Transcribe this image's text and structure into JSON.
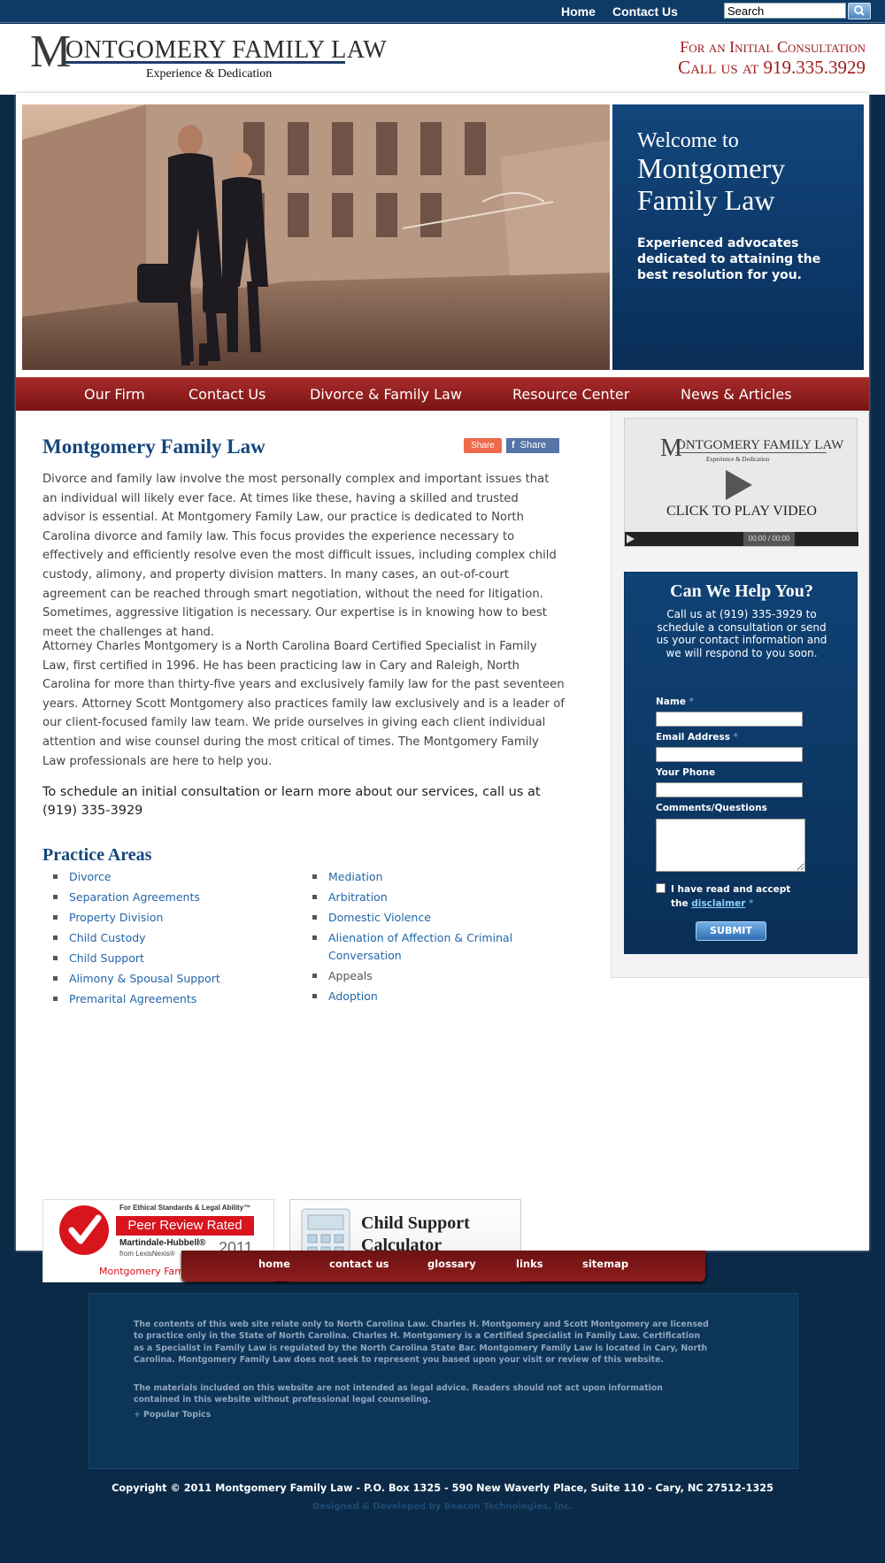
{
  "topbar": {
    "links": [
      "Home",
      "Contact Us"
    ],
    "search_value": "Search"
  },
  "header": {
    "logo_initial": "M",
    "logo_name": "ONTGOMERY FAMILY LAW",
    "logo_tagline": "Experience & Dedication",
    "consult_line1": "For an Initial Consultation",
    "consult_line2": "Call us at 919.335.3929"
  },
  "hero": {
    "welcome_line1": "Welcome to",
    "welcome_line2": "Montgomery Family Law",
    "welcome_sub": "Experienced advocates dedicated to attaining the best resolution for you."
  },
  "main_nav": [
    "Our Firm",
    "Contact Us",
    "Divorce & Family Law",
    "Resource Center",
    "News & Articles"
  ],
  "content": {
    "title": "Montgomery Family Law",
    "share_label_1": "Share",
    "share_label_2": "Share",
    "paragraph_1": "Divorce and family law involve the most personally complex and important issues that an individual will likely ever face. At times like these, having a skilled and trusted advisor is essential. At Montgomery Family Law, our practice is dedicated to North Carolina divorce and family law. This focus provides the experience necessary to effectively and efficiently resolve even the most difficult issues, including complex child custody, alimony, and property division matters. In many cases, an out-of-court agreement can be reached through smart negotiation, without the need for litigation. Sometimes, aggressive litigation is necessary. Our expertise is in knowing how to best meet the challenges at hand.",
    "paragraph_2": "Attorney Charles Montgomery is a North Carolina Board Certified Specialist in Family Law, first certified in 1996. He has been practicing law in Cary and Raleigh, North Carolina for more than thirty-five years and exclusively family law for the past seventeen years. Attorney Scott Montgomery also practices family law exclusively and is a leader of our client-focused family law team. We pride ourselves in giving each client individual attention and wise counsel during the most critical of times. The Montgomery Family Law professionals are here to help you.",
    "paragraph_3": "To schedule an initial consultation or learn more about our services, call us at (919) 335-3929",
    "practice_title": "Practice Areas",
    "practice_left": [
      "Divorce",
      "Separation Agreements",
      "Property Division",
      "Child Custody",
      "Child Support",
      "Alimony & Spousal Support",
      "Premarital Agreements"
    ],
    "practice_right": [
      "Mediation",
      "Arbitration",
      "Domestic Violence",
      "Alienation of Affection & Criminal Conversation",
      "Appeals",
      "Adoption"
    ],
    "badge_peer": {
      "top": "For Ethical Standards & Legal Ability™",
      "rated": "Peer Review Rated",
      "brand": "Martindale-Hubbell®",
      "from": "from LexisNexis®",
      "year": "2011",
      "firm": "Montgomery Family Law"
    },
    "badge_calc": "Child Support Calculator"
  },
  "sidebar": {
    "video": {
      "logo_initial": "M",
      "logo_name": "ONTGOMERY FAMILY LAW",
      "tagline": "Experience & Dedication",
      "cta": "CLICK TO PLAY VIDEO",
      "time": "00:00 / 00:00"
    },
    "help": {
      "title": "Can We Help You?",
      "text": "Call us at (919) 335-3929 to schedule a consultation or send us your contact information and we will respond to you soon.",
      "name_label": "Name",
      "email_label": "Email Address",
      "phone_label": "Your Phone",
      "comments_label": "Comments/Questions",
      "required": "*",
      "agree_prefix": "I have read and accept the",
      "disclaimer_link": "disclaimer",
      "submit": "SUBMIT"
    }
  },
  "footer": {
    "nav": [
      "home",
      "contact us",
      "glossary",
      "links",
      "sitemap"
    ],
    "disclaimer_1": "The contents of this web site relate only to North Carolina Law. Charles H. Montgomery and Scott Montgomery are licensed to practice only in the State of North Carolina. Charles H. Montgomery is a Certified Specialist in Family Law. Certification as a Specialist in Family Law is regulated by the North Carolina State Bar. Montgomery Family Law is located in Cary, North Carolina. Montgomery Family Law does not seek to represent you based upon your visit or review of this website.",
    "disclaimer_2": "The materials included on this website are not intended as legal advice. Readers should not act upon information contained in this website without professional legal counseling.",
    "popular_topics": "Popular Topics",
    "copyright": "Copyright © 2011 Montgomery Family Law - P.O. Box 1325 - 590 New Waverly Place, Suite 110 - Cary, NC 27512-1325",
    "credit": "Designed & Developed by Beacon Technologies, Inc."
  },
  "colors": {
    "navy": "#0e3a66",
    "nav_red": "#8e1d1d",
    "heading_blue": "#14467c",
    "link_blue": "#2366a8",
    "accent_red": "#a01b1b"
  }
}
